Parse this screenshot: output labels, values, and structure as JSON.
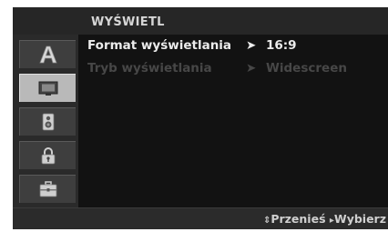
{
  "menu": {
    "title": "WYŚWIETL"
  },
  "sidebar": {
    "items": [
      {
        "icon": "language-icon",
        "selected": false
      },
      {
        "icon": "display-icon",
        "selected": true
      },
      {
        "icon": "audio-icon",
        "selected": false
      },
      {
        "icon": "lock-icon",
        "selected": false
      },
      {
        "icon": "toolbox-icon",
        "selected": false
      }
    ]
  },
  "settings": [
    {
      "label": "Format wyświetlania",
      "value": "16:9",
      "state": "active"
    },
    {
      "label": "Tryb wyświetlania",
      "value": "Widescreen",
      "state": "disabled"
    }
  ],
  "footer": {
    "move_glyph": "⇕",
    "move_label": "Przenieś",
    "select_glyph": "▸",
    "select_label": "Wybierz"
  },
  "colors": {
    "background": "#1c1c1c",
    "selected_item": "#b9b9b9",
    "text_active": "#ececec",
    "text_disabled": "#474747"
  }
}
